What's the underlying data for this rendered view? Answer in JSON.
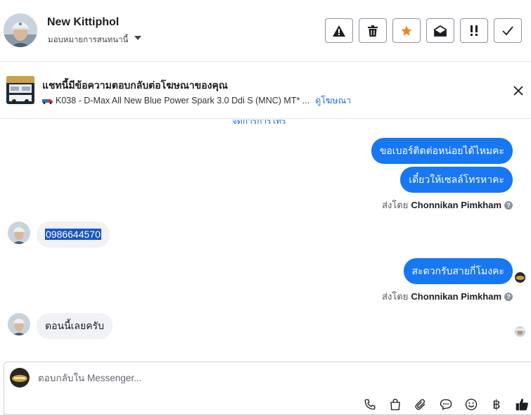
{
  "header": {
    "contact_name": "New Kittiphol",
    "assign_label": "มอบหมายการสนทนานี้",
    "toolbar": [
      {
        "icon": "warning-icon"
      },
      {
        "icon": "trash-icon"
      },
      {
        "icon": "star-icon",
        "color": "#f5821f"
      },
      {
        "icon": "mark-unread-icon"
      },
      {
        "icon": "follow-up-icon"
      },
      {
        "icon": "done-check-icon"
      }
    ]
  },
  "ad": {
    "title": "แชทนี้มีข้อความตอบกลับต่อโฆษณาของคุณ",
    "product": "K038 - D-Max All New Blue Power Spark 3.0 Ddi S (MNC) MT* ...",
    "view_ad_link": "ดูโฆษณา"
  },
  "thread": {
    "cut_off_text": "จัดการการโทร",
    "messages": [
      {
        "dir": "out",
        "text": "ขอเบอร์ติดต่อหน่อยได้ไหมคะ"
      },
      {
        "dir": "out",
        "text": "เดี๋ยวให้เซลล์โทรหาคะ"
      },
      {
        "dir": "in",
        "text": "0986644570"
      },
      {
        "dir": "out",
        "text": "สะดวกรับสายกี่โมงคะ"
      },
      {
        "dir": "in",
        "text": "ตอนนี้เลยครับ"
      }
    ],
    "sent_by_prefix": "ส่งโดย",
    "sent_by_name": "Chonnikan Pimkham"
  },
  "composer": {
    "placeholder": "ตอบกลับใน Messenger...",
    "currency_symbol": "฿"
  },
  "colors": {
    "outgoing_bubble": "#1877f2",
    "incoming_bubble": "#f0f2f5",
    "link": "#216fdb",
    "star": "#f5821f"
  }
}
